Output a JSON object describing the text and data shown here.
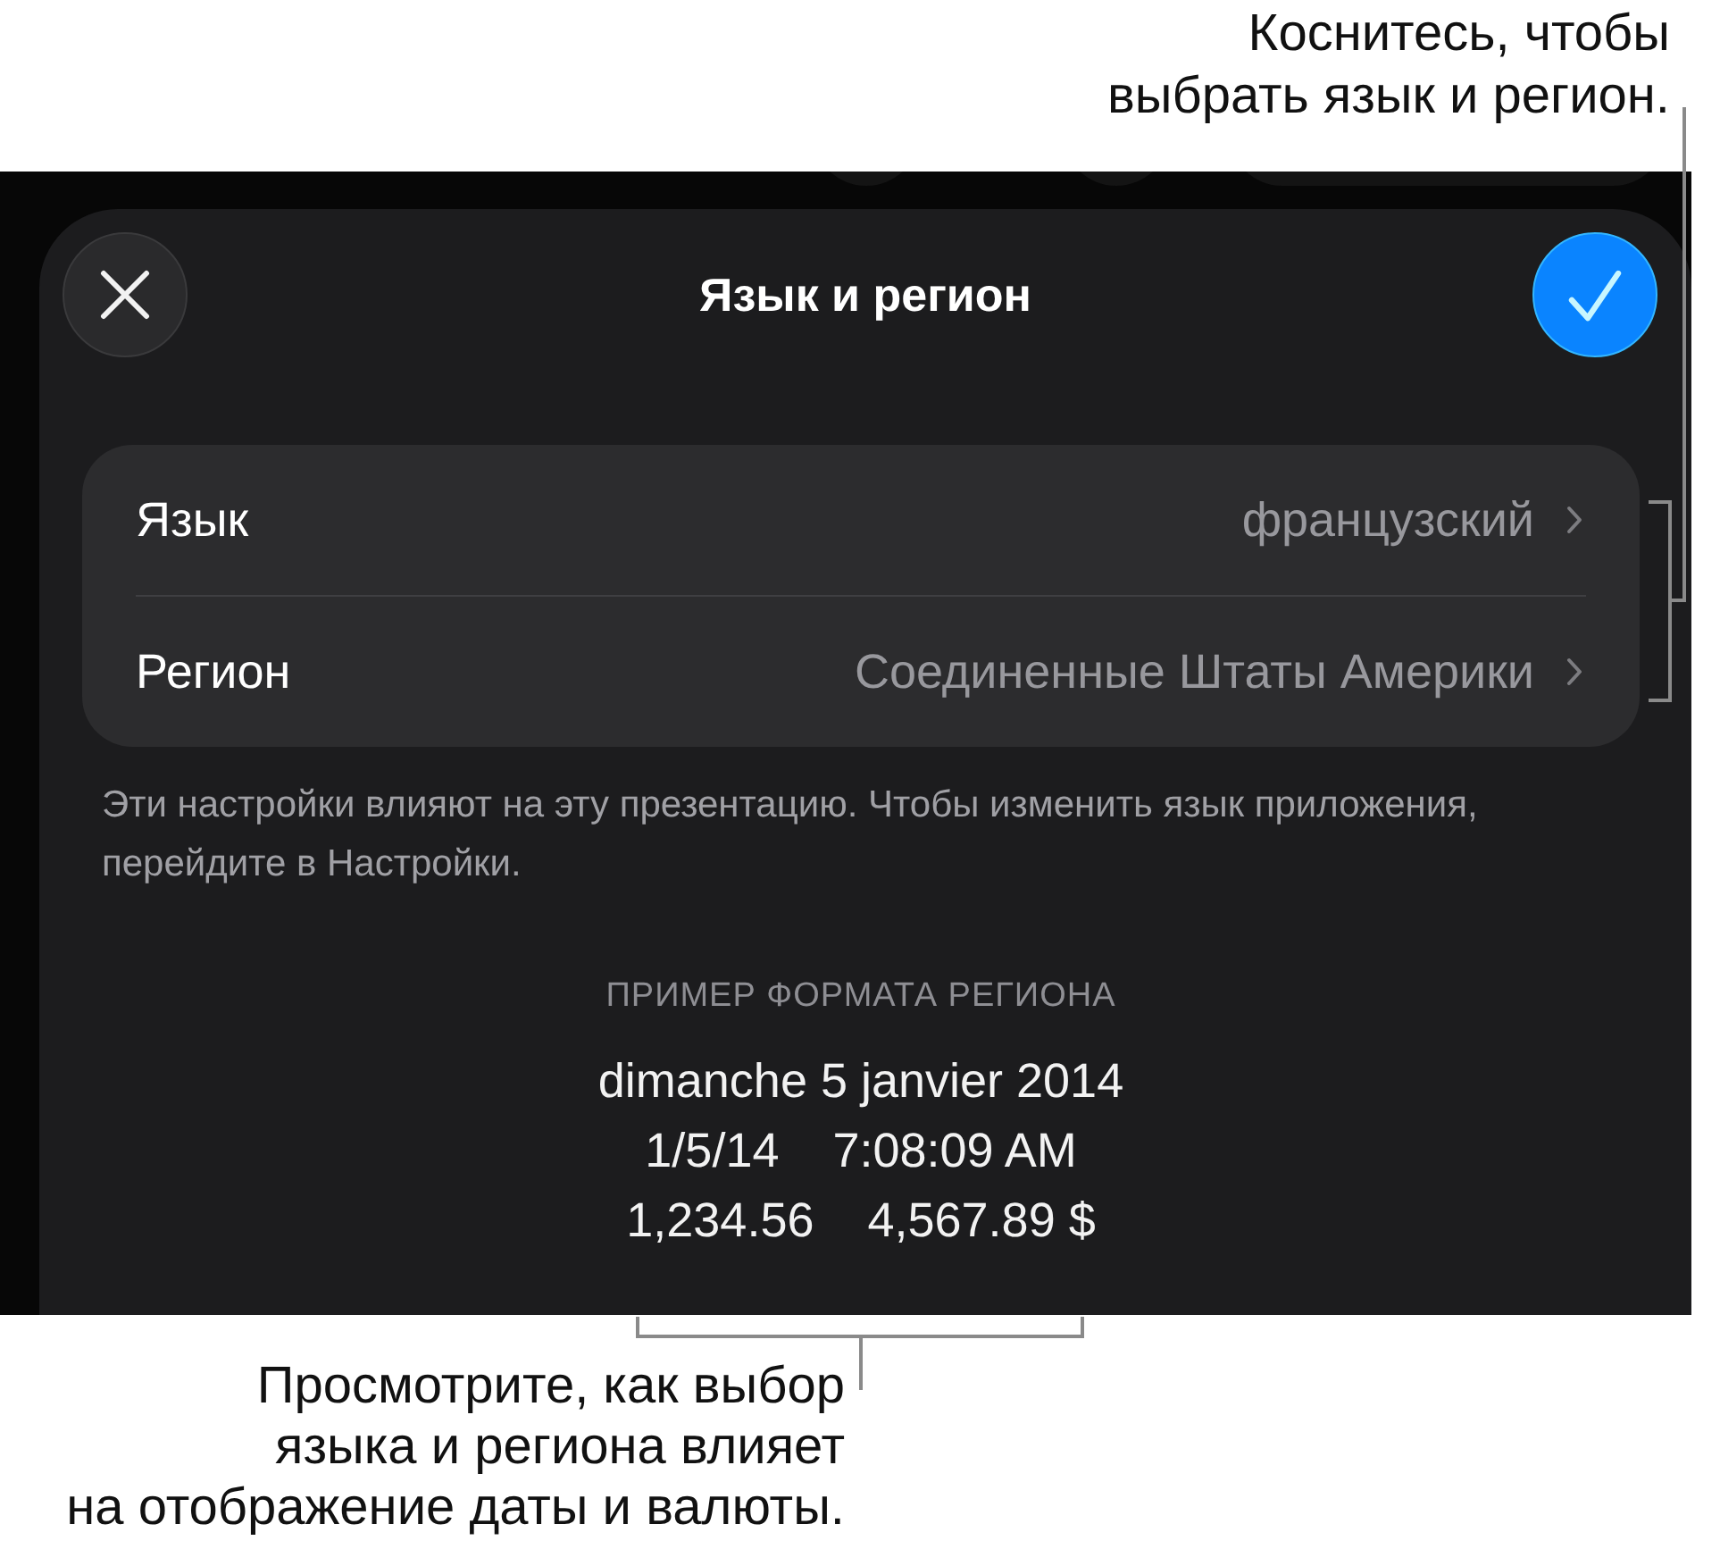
{
  "top_callout": "Коснитесь, чтобы\nвыбрать язык и регион.",
  "sheet": {
    "title": "Язык и регион",
    "rows": [
      {
        "label": "Язык",
        "value": "французский"
      },
      {
        "label": "Регион",
        "value": "Соединенные Штаты Америки"
      }
    ],
    "footnote": "Эти настройки влияют на эту презентацию. Чтобы изменить язык приложения, перейдите в Настройки.",
    "format_example": {
      "heading": "ПРИМЕР ФОРМАТА РЕГИОНА",
      "lines": [
        [
          "dimanche 5 janvier 2014"
        ],
        [
          "1/5/14",
          "7:08:09 AM"
        ],
        [
          "1,234.56",
          "4,567.89 $"
        ]
      ]
    }
  },
  "bottom_callout": "Просмотрите, как выбор\nязыка и региона влияет\nна отображение даты и валюты."
}
